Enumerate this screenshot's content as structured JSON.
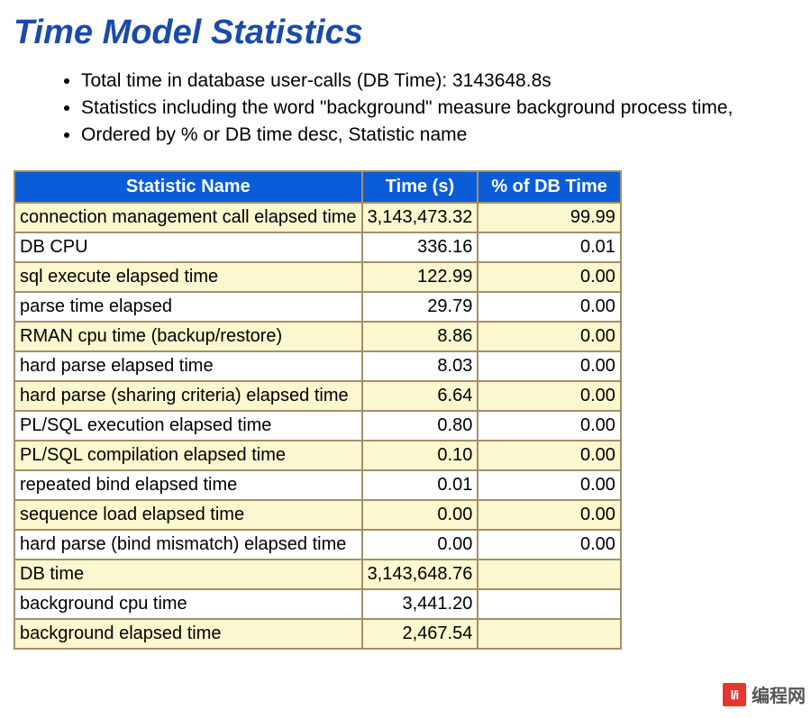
{
  "title": "Time Model Statistics",
  "notes": [
    "Total time in database user-calls (DB Time): 3143648.8s",
    "Statistics including the word \"background\" measure background process time,",
    "Ordered by % or DB time desc, Statistic name"
  ],
  "table": {
    "headers": [
      "Statistic Name",
      "Time (s)",
      "% of DB Time"
    ],
    "rows": [
      {
        "name": "connection management call elapsed time",
        "time": "3,143,473.32",
        "pct": "99.99"
      },
      {
        "name": "DB CPU",
        "time": "336.16",
        "pct": "0.01"
      },
      {
        "name": "sql execute elapsed time",
        "time": "122.99",
        "pct": "0.00"
      },
      {
        "name": "parse time elapsed",
        "time": "29.79",
        "pct": "0.00"
      },
      {
        "name": "RMAN cpu time (backup/restore)",
        "time": "8.86",
        "pct": "0.00"
      },
      {
        "name": "hard parse elapsed time",
        "time": "8.03",
        "pct": "0.00"
      },
      {
        "name": "hard parse (sharing criteria) elapsed time",
        "time": "6.64",
        "pct": "0.00"
      },
      {
        "name": "PL/SQL execution elapsed time",
        "time": "0.80",
        "pct": "0.00"
      },
      {
        "name": "PL/SQL compilation elapsed time",
        "time": "0.10",
        "pct": "0.00"
      },
      {
        "name": "repeated bind elapsed time",
        "time": "0.01",
        "pct": "0.00"
      },
      {
        "name": "sequence load elapsed time",
        "time": "0.00",
        "pct": "0.00"
      },
      {
        "name": "hard parse (bind mismatch) elapsed time",
        "time": "0.00",
        "pct": "0.00"
      },
      {
        "name": "DB time",
        "time": "3,143,648.76",
        "pct": ""
      },
      {
        "name": "background cpu time",
        "time": "3,441.20",
        "pct": ""
      },
      {
        "name": "background elapsed time",
        "time": "2,467.54",
        "pct": ""
      }
    ]
  },
  "watermark": {
    "logo_text": "l/i",
    "label": "编程网"
  }
}
